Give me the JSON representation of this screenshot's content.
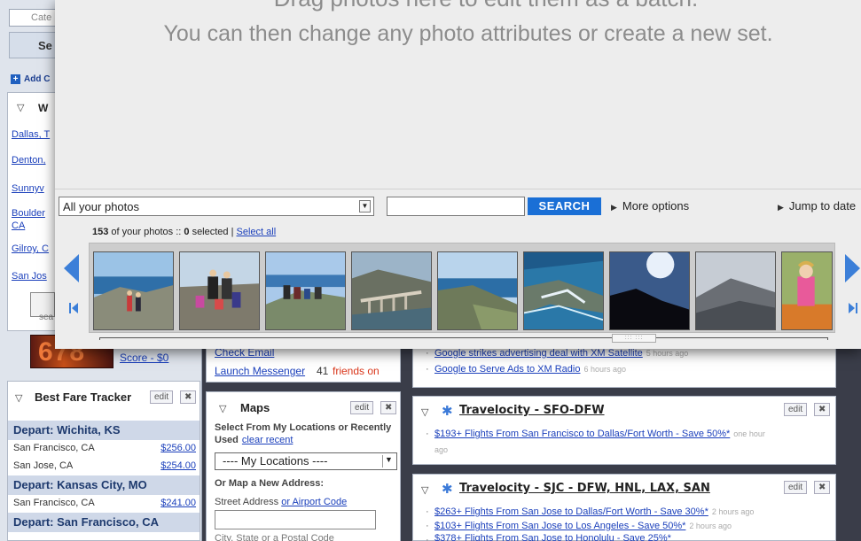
{
  "portal": {
    "category_placeholder": "Cate",
    "search_btn": "Se",
    "add_content": "Add C",
    "weather_title": "W",
    "weather_links": [
      "Dallas, T",
      "Denton,",
      "Sunnyv",
      "Boulder",
      "CA",
      "Gilroy, C",
      "San Jos"
    ],
    "search_small": "sea",
    "score_img_text": "678",
    "score_link": "Score - $0",
    "bft": {
      "title": "Best Fare Tracker",
      "edit": "edit",
      "close": "✖",
      "groups": [
        {
          "depart": "Depart: Wichita, KS",
          "rows": [
            {
              "city": "San Francisco, CA",
              "price": "$256.00"
            },
            {
              "city": "San Jose, CA",
              "price": "$254.00"
            }
          ]
        },
        {
          "depart": "Depart: Kansas City, MO",
          "rows": [
            {
              "city": "San Francisco, CA",
              "price": "$241.00"
            }
          ]
        },
        {
          "depart": "Depart: San Francisco, CA",
          "rows": []
        }
      ]
    },
    "messenger": {
      "check_email": "Check Email",
      "launch": "Launch Messenger",
      "count": "41",
      "friends_on": "friends on"
    },
    "maps": {
      "title": "Maps",
      "edit": "edit",
      "close": "✖",
      "select_label": "Select From My Locations or Recently Used",
      "clear_recent": "clear recent",
      "dropdown_value": "---- My Locations ----",
      "or_map": "Or Map a New Address:",
      "street_address": "Street Address",
      "or_airport": "or Airport Code",
      "city_state": "City, State or a Postal Code"
    },
    "news": [
      {
        "text": "Google strikes advertising deal with XM Satellite",
        "ago": "5 hours ago"
      },
      {
        "text": "Google to Serve Ads to XM Radio",
        "ago": "6 hours ago"
      }
    ],
    "trav1": {
      "title": "Travelocity - SFO-DFW",
      "edit": "edit",
      "close": "✖",
      "links": [
        {
          "text": "$193+ Flights From San Francisco to Dallas/Fort Worth - Save 50%*",
          "ago": "one hour"
        },
        {
          "text": "",
          "ago": "ago"
        }
      ]
    },
    "trav2": {
      "title": "Travelocity - SJC - DFW, HNL, LAX, SAN",
      "edit": "edit",
      "close": "✖",
      "links": [
        {
          "text": "$263+ Flights From San Jose to Dallas/Fort Worth - Save 30%*",
          "ago": "2 hours ago"
        },
        {
          "text": "$103+ Flights From San Jose to Los Angeles - Save 50%*",
          "ago": "2 hours ago"
        },
        {
          "text": "$378+ Flights From San Jose to Honolulu - Save 25%*",
          "ago": ""
        }
      ]
    }
  },
  "organizer": {
    "drop_line1": "Drag photos here to edit them as a batch.",
    "drop_line2": "You can then change any photo attributes or create a new set.",
    "filter_value": "All your photos",
    "search_value": "",
    "search_button": "SEARCH",
    "more_options": "More options",
    "jump_to_date": "Jump to date",
    "count_number": "153",
    "count_text_a": "of your photos ::",
    "selected_number": "0",
    "selected_text": "selected |",
    "select_all": "Select all",
    "accent_color": "#1a6fd6",
    "thumbnails": [
      {
        "name": "coast-group-photo"
      },
      {
        "name": "family-on-rocks-photo"
      },
      {
        "name": "group-at-cliff-photo"
      },
      {
        "name": "bixby-bridge-photo"
      },
      {
        "name": "coastline-photo"
      },
      {
        "name": "ocean-rocks-photo"
      },
      {
        "name": "sun-silhouette-photo"
      },
      {
        "name": "misty-hills-photo"
      },
      {
        "name": "child-playground-photo"
      }
    ]
  }
}
